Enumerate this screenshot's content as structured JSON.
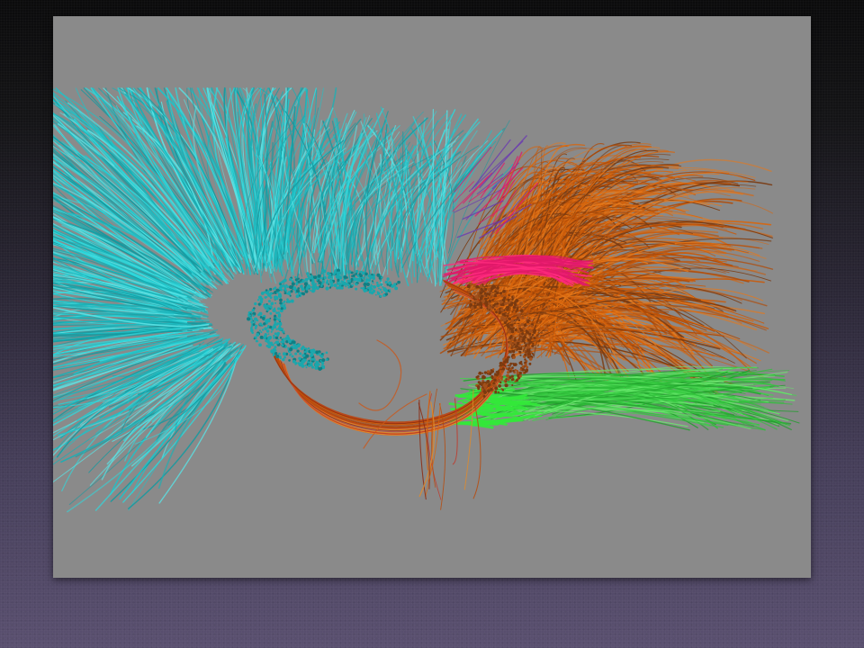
{
  "slide": {
    "background_top": "#0b0b0c",
    "background_bottom": "#5a5070"
  },
  "figure": {
    "background_color": "#8a8a8a",
    "bundle_colors": {
      "cyan": "#1fc2c8",
      "orange": "#d8650c",
      "green": "#3fd64a",
      "magenta": "#e0196a",
      "purple": "#6a3ab0",
      "dark_orange": "#7a3a10"
    }
  }
}
